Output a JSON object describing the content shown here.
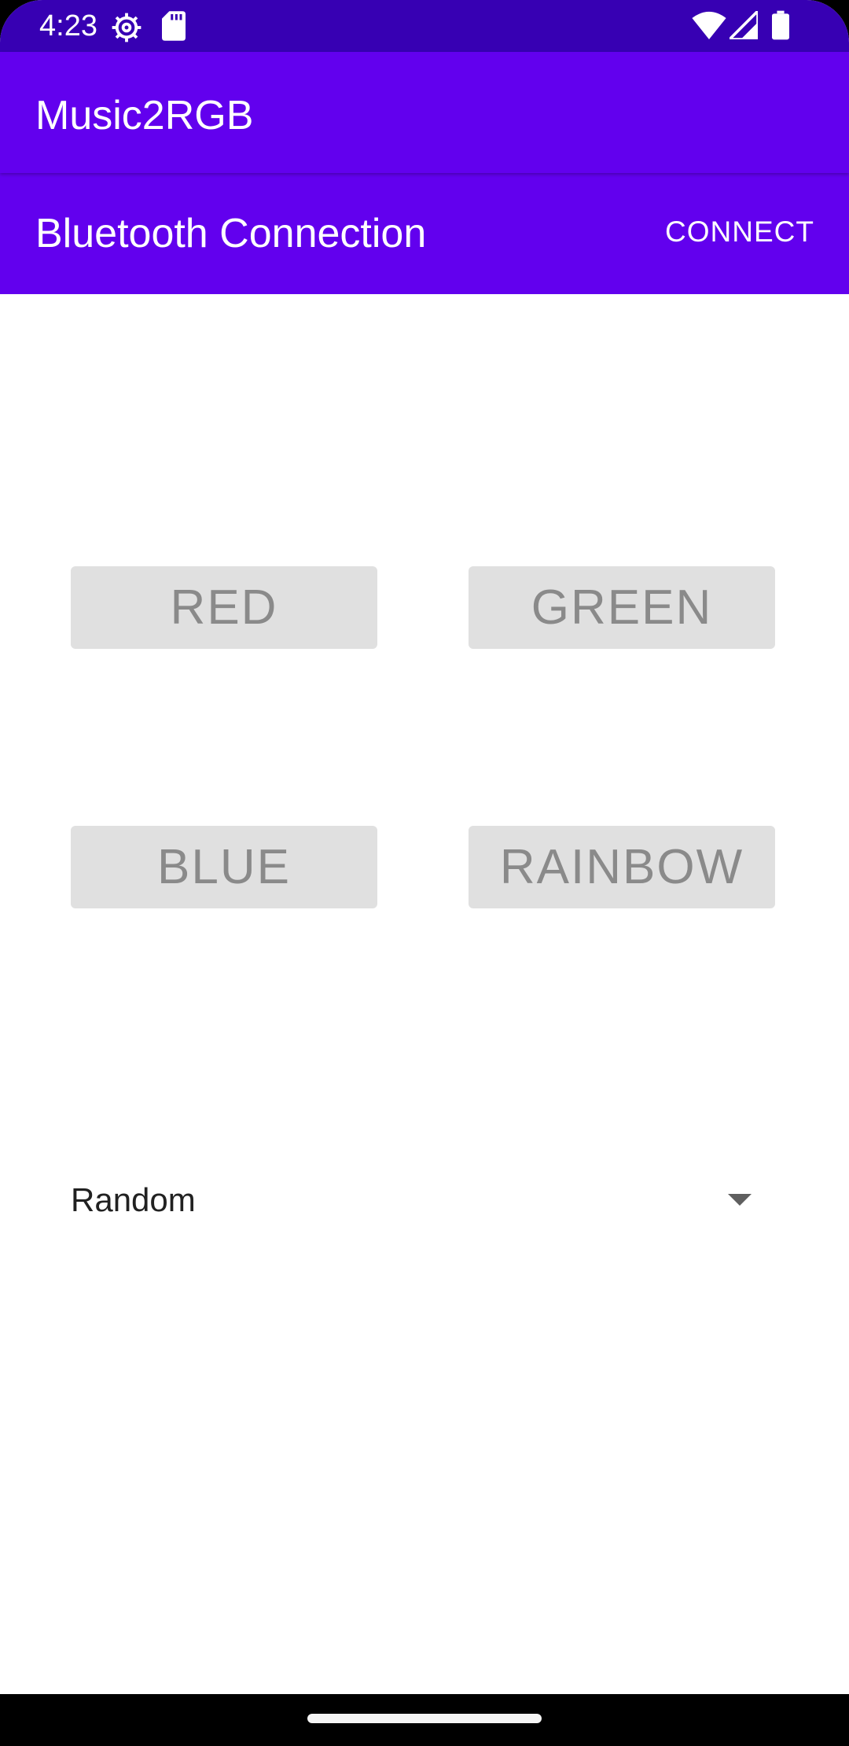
{
  "status_bar": {
    "time": "4:23",
    "left_icons": [
      "settings-gear-icon",
      "sd-card-icon"
    ],
    "right_icons": [
      "wifi-icon",
      "cell-signal-icon",
      "battery-icon"
    ]
  },
  "app_bar": {
    "title": "Music2RGB"
  },
  "bluetooth": {
    "title": "Bluetooth Connection",
    "connect_label": "CONNECT"
  },
  "color_buttons": {
    "red": "RED",
    "green": "GREEN",
    "blue": "BLUE",
    "rainbow": "RAINBOW"
  },
  "mode_spinner": {
    "selected": "Random",
    "icon": "dropdown-arrow-icon"
  },
  "colors": {
    "primary": "#6200ee",
    "primary_dark": "#3700b3",
    "button_bg": "#e0e0e0",
    "button_text": "#8a8a8a"
  }
}
